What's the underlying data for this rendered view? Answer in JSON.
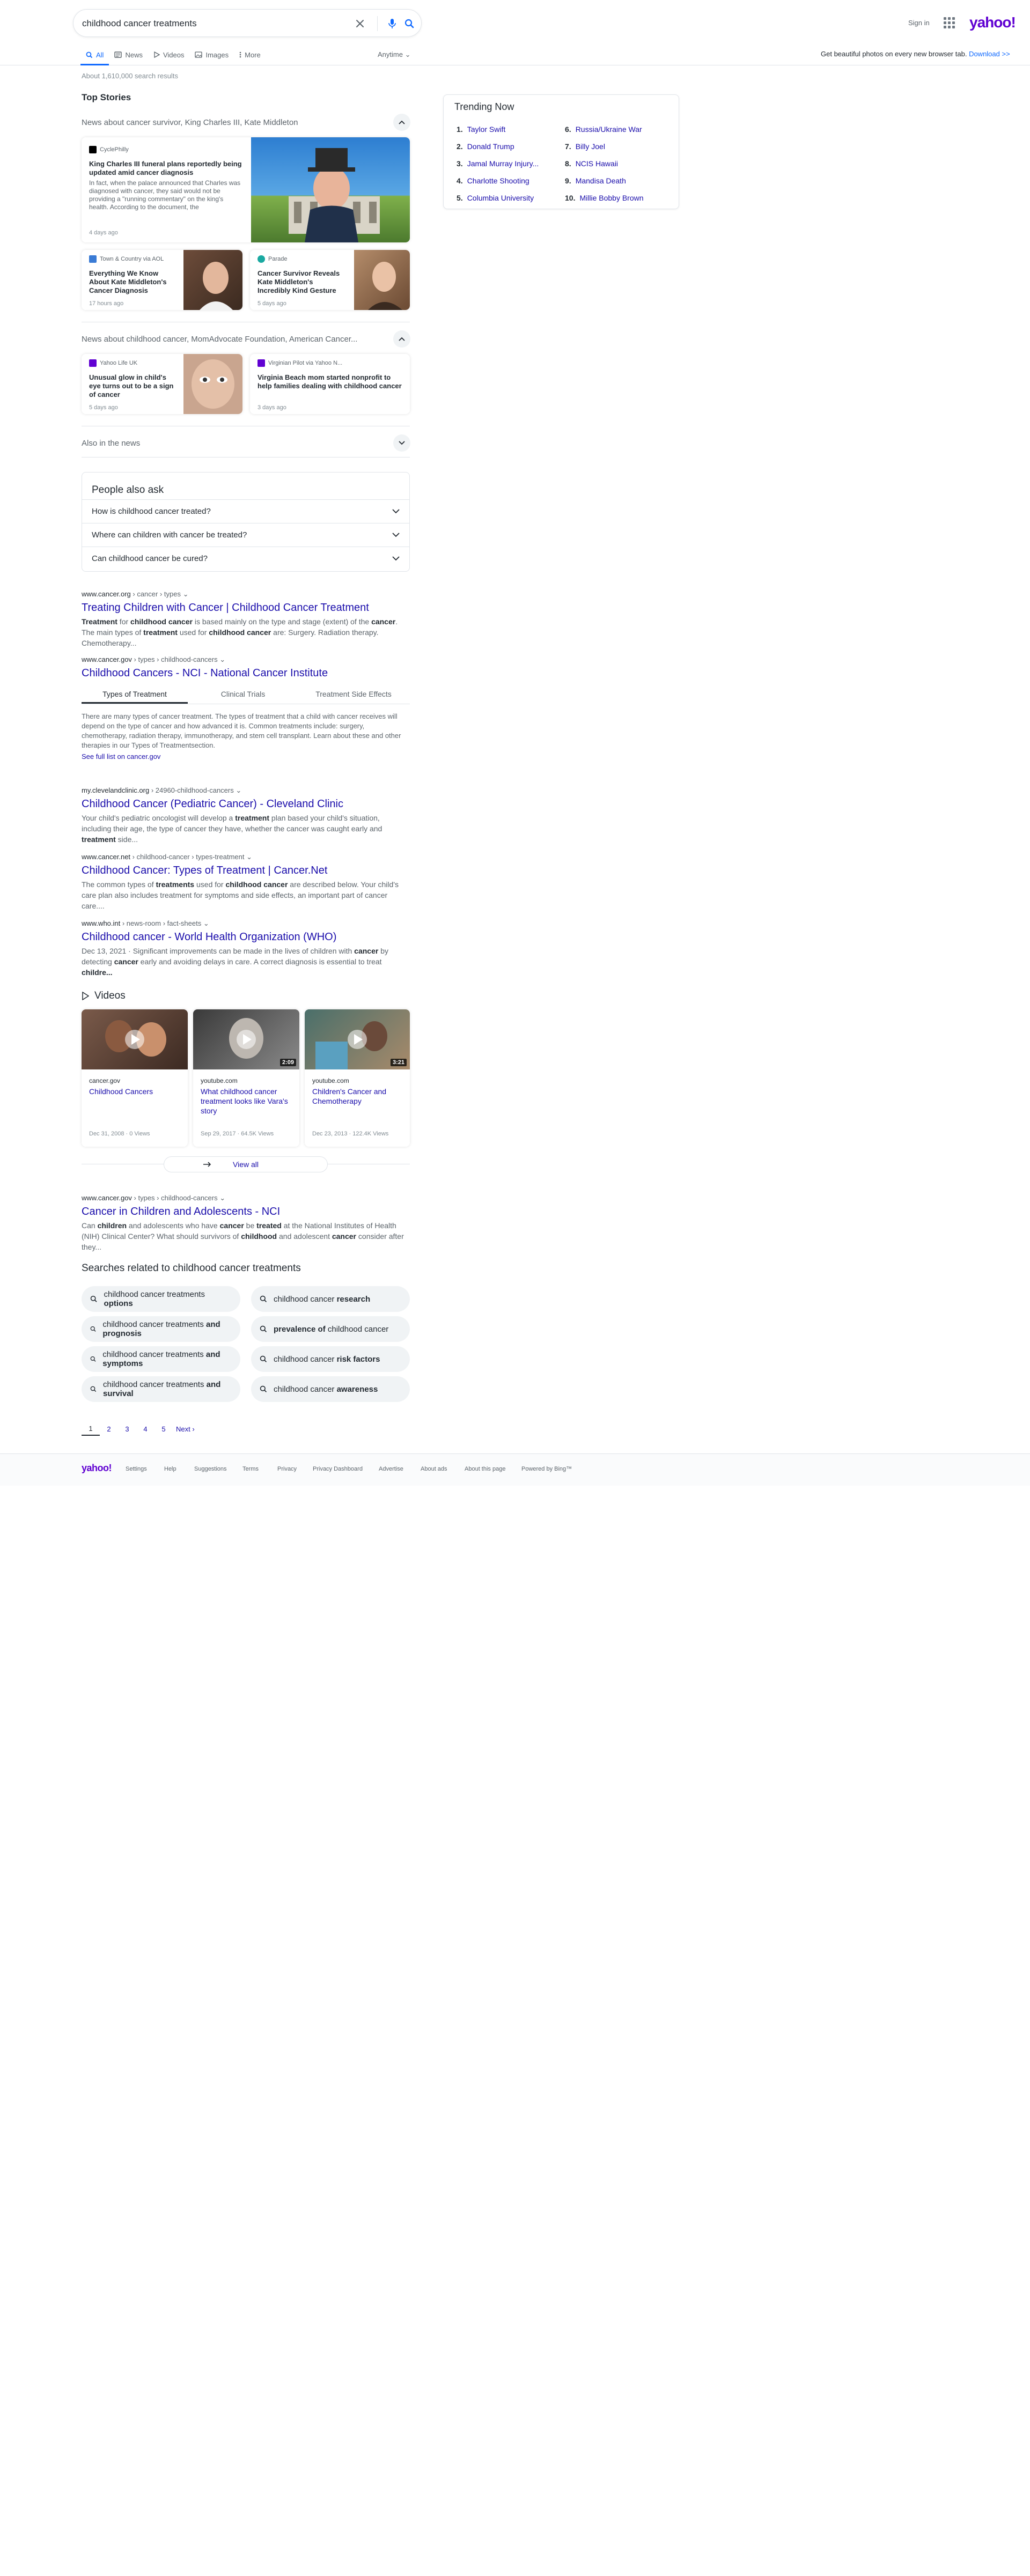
{
  "search": {
    "query": "childhood cancer treatments"
  },
  "header": {
    "signin": "Sign in",
    "logo": "yahoo!",
    "tabs": [
      {
        "label": "All",
        "icon": "search-icon"
      },
      {
        "label": "News",
        "icon": "news-icon"
      },
      {
        "label": "Videos",
        "icon": "play-icon"
      },
      {
        "label": "Images",
        "icon": "image-icon"
      },
      {
        "label": "More",
        "icon": "more-icon"
      }
    ],
    "anytime": "Anytime",
    "promo_text": "Get beautiful photos on every new browser tab.",
    "promo_link": "Download >>"
  },
  "result_count": "About 1,610,000 search results",
  "top_stories": {
    "heading": "Top Stories",
    "group1": {
      "header": "News about cancer survivor, King Charles III, Kate Middleton",
      "main": {
        "source": "CyclePhilly",
        "title": "King Charles III funeral plans reportedly being updated amid cancer diagnosis",
        "body": "In fact, when the palace announced that Charles was diagnosed with cancer, they said would not be providing a \"running commentary\" on the king's health. According to the document, the",
        "time": "4 days ago"
      },
      "small": [
        {
          "source": "Town & Country via AOL",
          "title": "Everything We Know About Kate Middleton's Cancer Diagnosis",
          "time": "17 hours ago"
        },
        {
          "source": "Parade",
          "title": "Cancer Survivor Reveals Kate Middleton's Incredibly Kind Gesture",
          "time": "5 days ago"
        }
      ]
    },
    "group2": {
      "header": "News about childhood cancer, MomAdvocate Foundation, American Cancer...",
      "items": [
        {
          "source": "Yahoo Life UK",
          "title": "Unusual glow in child's eye turns out to be a sign of cancer",
          "time": "5 days ago"
        },
        {
          "source": "Virginian Pilot via Yahoo N...",
          "title": "Virginia Beach mom started nonprofit to help families dealing with childhood cancer",
          "time": "3 days ago"
        }
      ]
    },
    "also": "Also in the news"
  },
  "paa": {
    "heading": "People also ask",
    "questions": [
      "How is childhood cancer treated?",
      "Where can children with cancer be treated?",
      "Can childhood cancer be cured?"
    ]
  },
  "results": [
    {
      "domain": "www.cancer.org",
      "path": " › cancer › types",
      "title": "Treating Children with Cancer | Childhood Cancer Treatment",
      "snippet_html": "<b>Treatment</b> for <b>childhood cancer</b> is based mainly on the type and stage (extent) of the <b>cancer</b>. The main types of <b>treatment</b> used for <b>childhood cancer</b> are: Surgery. Radiation therapy. Chemotherapy..."
    },
    {
      "domain": "www.cancer.gov",
      "path": " › types › childhood-cancers",
      "title": "Childhood Cancers - NCI - National Cancer Institute",
      "tabs": [
        "Types of Treatment",
        "Clinical Trials",
        "Treatment Side Effects"
      ],
      "snippet_html": "There are many types of cancer treatment. The types of treatment that a child with cancer receives will depend on the type of cancer and how advanced it is. Common treatments include: surgery, chemotherapy, radiation therapy, immunotherapy, and stem cell transplant. Learn about these and other therapies in our Types of Treatmentsection.",
      "more": "See full list on cancer.gov"
    },
    {
      "domain": "my.clevelandclinic.org",
      "path": " › 24960-childhood-cancers",
      "title": "Childhood Cancer (Pediatric Cancer) - Cleveland Clinic",
      "snippet_html": "Your child's pediatric oncologist will develop a <b>treatment</b> plan based your child's situation, including their age, the type of cancer they have, whether the cancer was caught early and <b>treatment</b> side..."
    },
    {
      "domain": "www.cancer.net",
      "path": " › childhood-cancer › types-treatment",
      "title": "Childhood Cancer: Types of Treatment | Cancer.Net",
      "snippet_html": "The common types of <b>treatments</b> used for <b>childhood cancer</b> are described below. Your child's care plan also includes treatment for symptoms and side effects, an important part of cancer care...."
    },
    {
      "domain": "www.who.int",
      "path": " › news-room › fact-sheets",
      "title": "Childhood cancer - World Health Organization (WHO)",
      "snippet_html": "Dec 13, 2021 · Significant improvements can be made in the lives of children with <b>cancer</b> by detecting <b>cancer</b> early and avoiding delays in care. A correct diagnosis is essential to treat <b>childre...</b>"
    }
  ],
  "videos": {
    "heading": "Videos",
    "items": [
      {
        "site": "cancer.gov",
        "title": "Childhood Cancers",
        "meta": "Dec 31, 2008 · 0 Views",
        "duration": ""
      },
      {
        "site": "youtube.com",
        "title": "What childhood cancer treatment looks like Vara's story",
        "meta": "Sep 29, 2017 · 64.5K Views",
        "duration": "2:09"
      },
      {
        "site": "youtube.com",
        "title": "Children's Cancer and Chemotherapy",
        "meta": "Dec 23, 2013 · 122.4K Views",
        "duration": "3:21"
      }
    ],
    "view_all": "View all"
  },
  "result_last": {
    "domain": "www.cancer.gov",
    "path": " › types › childhood-cancers",
    "title": "Cancer in Children and Adolescents - NCI",
    "snippet_html": "Can <b>children</b> and adolescents who have <b>cancer</b> be <b>treated</b> at the National Institutes of Health (NIH) Clinical Center? What should survivors of <b>childhood</b> and adolescent <b>cancer</b> consider after they..."
  },
  "related": {
    "heading": "Searches related to childhood cancer treatments",
    "items": [
      {
        "html": "childhood cancer treatments <b>options</b>"
      },
      {
        "html": "childhood cancer <b>research</b>"
      },
      {
        "html": "childhood cancer treatments <b>and prognosis</b>"
      },
      {
        "html": "<b>prevalence of</b> childhood cancer"
      },
      {
        "html": "childhood cancer treatments <b>and symptoms</b>"
      },
      {
        "html": "childhood cancer <b>risk factors</b>"
      },
      {
        "html": "childhood cancer treatments <b>and survival</b>"
      },
      {
        "html": "childhood cancer <b>awareness</b>"
      }
    ]
  },
  "pagination": {
    "pages": [
      "1",
      "2",
      "3",
      "4",
      "5"
    ],
    "next": "Next"
  },
  "trending": {
    "heading": "Trending Now",
    "items": [
      "Taylor Swift",
      "Donald Trump",
      "Jamal Murray Injury...",
      "Charlotte Shooting",
      "Columbia University",
      "Russia/Ukraine War",
      "Billy Joel",
      "NCIS Hawaii",
      "Mandisa Death",
      "Millie Bobby Brown"
    ]
  },
  "footer": {
    "logo": "yahoo!",
    "links": [
      "Settings",
      "Help",
      "Suggestions",
      "Terms",
      "Privacy",
      "Privacy Dashboard",
      "Advertise",
      "About ads",
      "About this page",
      "Powered by Bing™"
    ]
  },
  "colors": {
    "brand": "#6001d2",
    "link": "#1a0dab",
    "accent": "#0f69ff"
  }
}
